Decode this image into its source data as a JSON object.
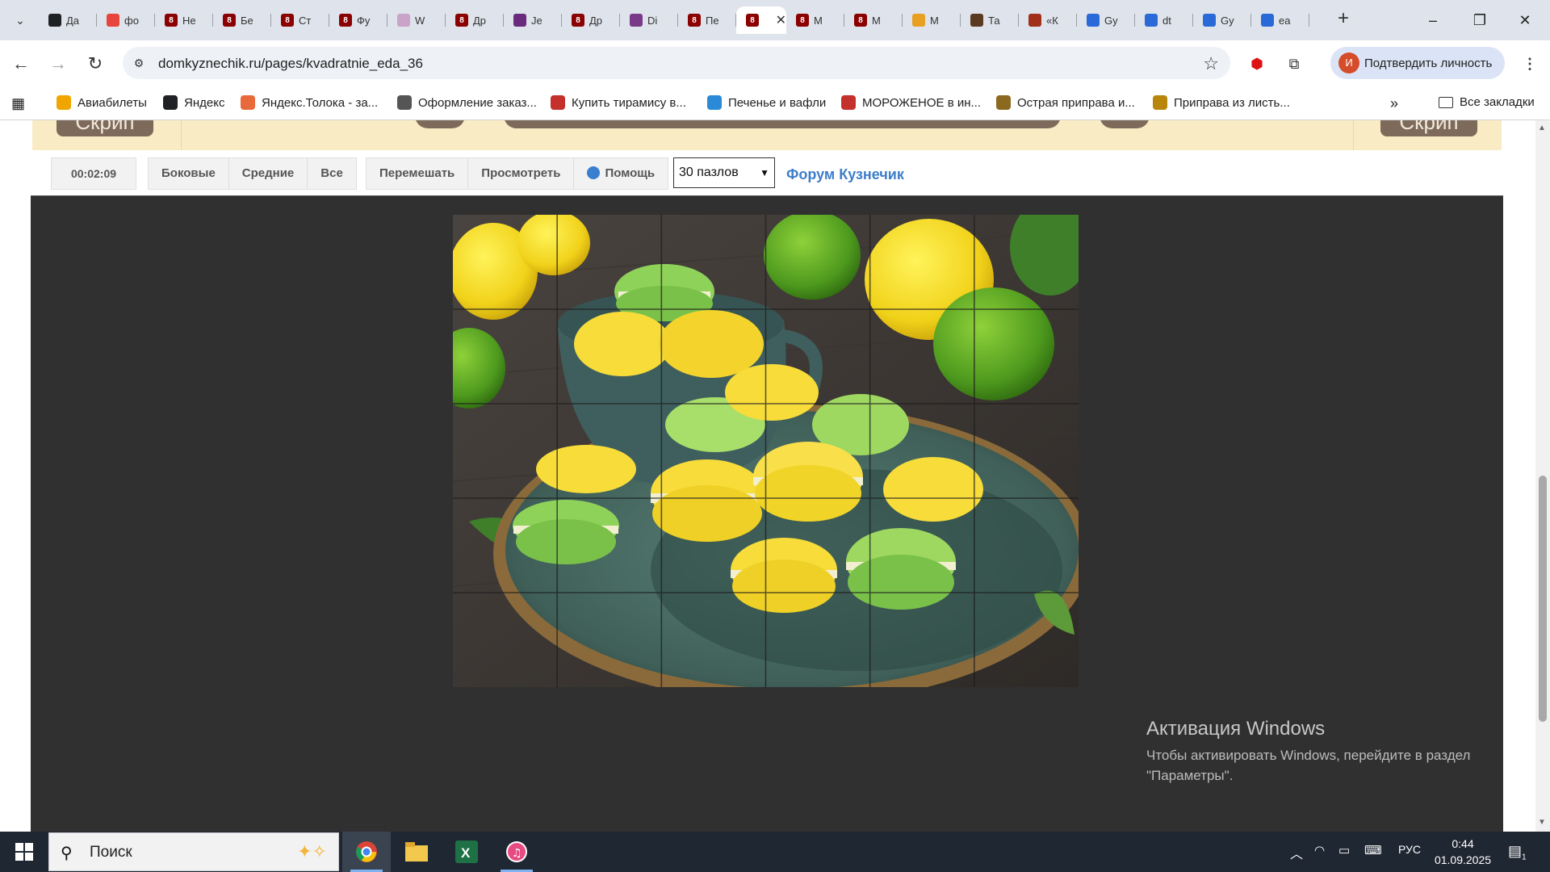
{
  "browser": {
    "tabs": [
      {
        "title": "Да",
        "icon_color": "#202124",
        "icon": "plus-badge"
      },
      {
        "title": "фо",
        "icon_color": "#e8453c",
        "icon": "yandex"
      },
      {
        "title": "Не",
        "icon_color": "#8b0000",
        "icon": "kuznechik"
      },
      {
        "title": "Бе",
        "icon_color": "#8b0000",
        "icon": "kuznechik"
      },
      {
        "title": "Ст",
        "icon_color": "#8b0000",
        "icon": "kuznechik"
      },
      {
        "title": "Фу",
        "icon_color": "#8b0000",
        "icon": "kuznechik"
      },
      {
        "title": "W",
        "icon_color": "#c9a4c8",
        "icon": "generic"
      },
      {
        "title": "Др",
        "icon_color": "#8b0000",
        "icon": "kuznechik"
      },
      {
        "title": "Je",
        "icon_color": "#6a2b7e",
        "icon": "generic"
      },
      {
        "title": "Др",
        "icon_color": "#8b0000",
        "icon": "kuznechik"
      },
      {
        "title": "Di",
        "icon_color": "#7a3a8a",
        "icon": "generic"
      },
      {
        "title": "Пе",
        "icon_color": "#8b0000",
        "icon": "kuznechik"
      },
      {
        "title": "",
        "icon_color": "#8b0000",
        "icon": "kuznechik",
        "active": true
      },
      {
        "title": "М",
        "icon_color": "#8b0000",
        "icon": "kuznechik"
      },
      {
        "title": "М",
        "icon_color": "#8b0000",
        "icon": "kuznechik"
      },
      {
        "title": "М",
        "icon_color": "#e8a020",
        "icon": "generic"
      },
      {
        "title": "Та",
        "icon_color": "#5a3a20",
        "icon": "generic"
      },
      {
        "title": "«К",
        "icon_color": "#a0301a",
        "icon": "generic"
      },
      {
        "title": "Gy",
        "icon_color": "#2a6ad8",
        "icon": "generic"
      },
      {
        "title": "dt",
        "icon_color": "#2a6ad8",
        "icon": "generic"
      },
      {
        "title": "Gy",
        "icon_color": "#2a6ad8",
        "icon": "generic"
      },
      {
        "title": "ea",
        "icon_color": "#2a6ad8",
        "icon": "generic"
      }
    ],
    "url": "domkyznechik.ru/pages/kvadratnie_eda_36",
    "profile_label": "Подтвердить личность",
    "profile_initial": "И",
    "bookmarks": [
      {
        "label": "Авиабилеты",
        "icon_color": "#f0a500"
      },
      {
        "label": "Яндекс",
        "icon_color": "#202124"
      },
      {
        "label": "Яндекс.Толока - за...",
        "icon_color": "#e86a3a"
      },
      {
        "label": "Оформление заказ...",
        "icon_color": "#555555"
      },
      {
        "label": "Купить тирамису в...",
        "icon_color": "#c4302b"
      },
      {
        "label": "Печенье и вафли",
        "icon_color": "#2a8ad8"
      },
      {
        "label": "МОРОЖЕНОЕ в ин...",
        "icon_color": "#c4302b"
      },
      {
        "label": "Острая приправа и...",
        "icon_color": "#8b6a20"
      },
      {
        "label": "Приправа из листь...",
        "icon_color": "#b8860b"
      }
    ],
    "all_bookmarks_label": "Все закладки"
  },
  "page": {
    "banner_left": "Скрип",
    "banner_right": "Скрип",
    "timer": "00:02:09",
    "filter_buttons": [
      "Боковые",
      "Средние",
      "Все"
    ],
    "action_buttons": [
      "Перемешать",
      "Просмотреть",
      "Помощь"
    ],
    "pieces_select": "30 пазлов",
    "forum_link": "Форум Кузнечик",
    "puzzle": {
      "cols": 6,
      "rows": 5
    }
  },
  "windows": {
    "activation_title": "Активация Windows",
    "activation_line1": "Чтобы активировать Windows, перейдите в раздел",
    "activation_line2": "\"Параметры\".",
    "search_placeholder": "Поиск",
    "language": "РУС",
    "time": "0:44",
    "date": "01.09.2025",
    "notification_count": "1"
  }
}
